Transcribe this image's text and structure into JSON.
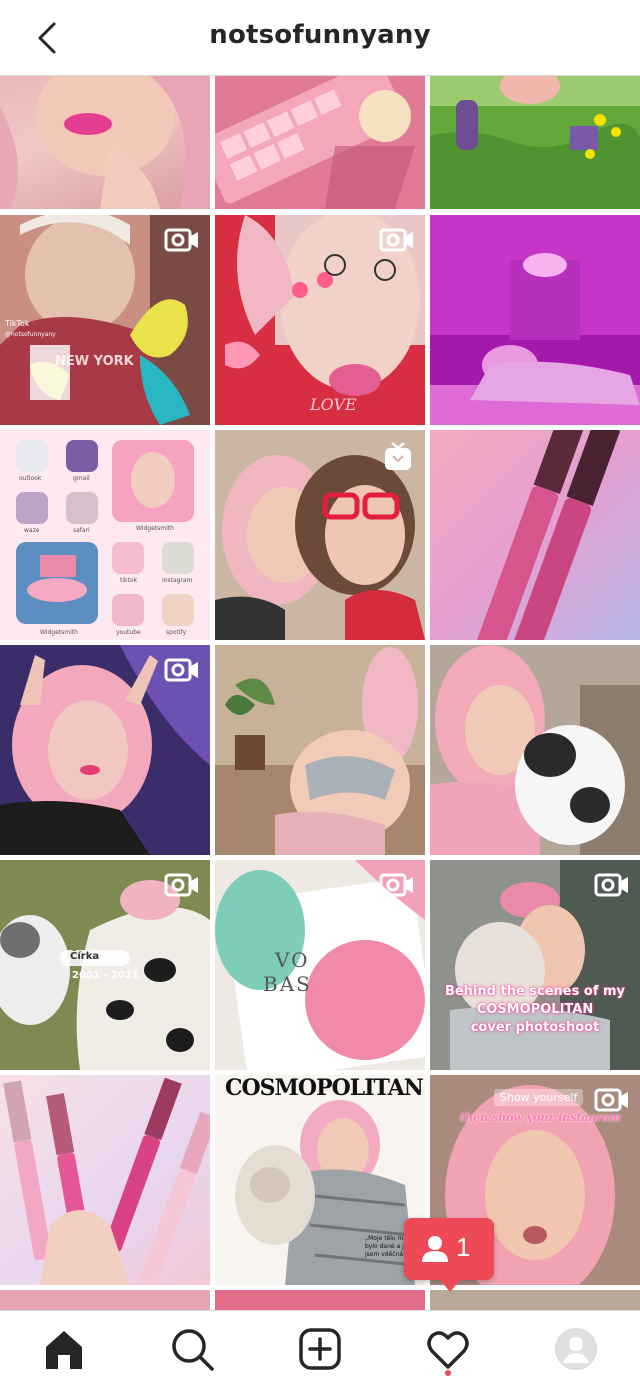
{
  "header": {
    "username": "notsofunnyany"
  },
  "grid": {
    "tiles": [
      {
        "type": "photo"
      },
      {
        "type": "photo"
      },
      {
        "type": "photo"
      },
      {
        "type": "reel"
      },
      {
        "type": "reel"
      },
      {
        "type": "photo"
      },
      {
        "type": "photo"
      },
      {
        "type": "igtv"
      },
      {
        "type": "photo"
      },
      {
        "type": "reel"
      },
      {
        "type": "photo"
      },
      {
        "type": "photo"
      },
      {
        "type": "reel"
      },
      {
        "type": "reel"
      },
      {
        "type": "reel"
      },
      {
        "type": "photo"
      },
      {
        "type": "photo"
      },
      {
        "type": "reel"
      }
    ],
    "tile4_overlay": {
      "tiktok": "TikTok",
      "handle": "@notsofunnyany"
    },
    "tile7_apps": [
      "outlook",
      "gmail",
      "Widgetsmith",
      "waze",
      "safari",
      "Widgetsmith",
      "tiktok",
      "instagram",
      "youtube",
      "spotify"
    ],
    "tile13_overlay": {
      "name": "Čírka",
      "years": "2001 - 2021"
    },
    "tile14_overlay": {
      "text1": "VO",
      "text2": "BAS"
    },
    "tile15_overlay": {
      "line1": "Behind the scenes of my",
      "line2": "COSMOPOLITAN",
      "line3": "cover photoshoot"
    },
    "tile17_overlay": {
      "masthead": "COSMOPOLITAN",
      "quote": "„Moje tělo mi bylo dané a já jsem vděčná!“"
    },
    "tile18_overlay": {
      "pill": "Show yourself",
      "script": "then show your instagram"
    }
  },
  "activity": {
    "count": "1"
  },
  "nav": {
    "items": [
      "home",
      "search",
      "create",
      "activity",
      "profile"
    ]
  },
  "colors": {
    "accent_red": "#ed4956",
    "pink": "#ff7fb0"
  }
}
